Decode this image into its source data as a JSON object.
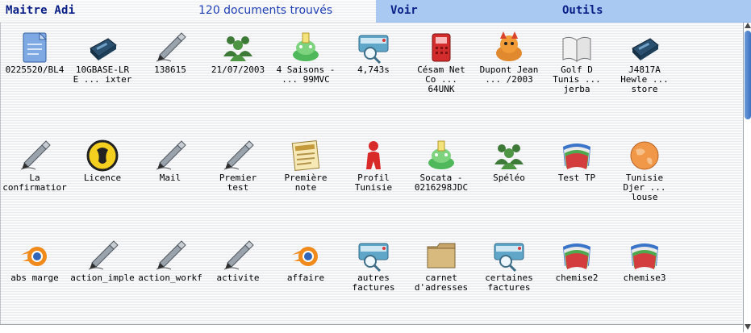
{
  "header": {
    "app_title": "Maitre Adi",
    "doc_count": "120 documents trouvés",
    "menu_voir": "Voir",
    "menu_outils": "Outils"
  },
  "colors": {
    "accent": "#a9c9f2",
    "title": "#0a1f86",
    "count": "#1f3fb3"
  },
  "items": [
    {
      "label": "0225520/BL4",
      "icon": "doc-icon"
    },
    {
      "label": "10GBASE-LR\nE ... ixter",
      "icon": "network-icon"
    },
    {
      "label": "138615",
      "icon": "pen-icon"
    },
    {
      "label": "21/07/2003",
      "icon": "people-icon"
    },
    {
      "label": "4 Saisons -\n... 99MVC",
      "icon": "frog-icon"
    },
    {
      "label": "4,743s",
      "icon": "search-doc-icon"
    },
    {
      "label": "Césam Net\nCo ...\n64UNK",
      "icon": "phone-icon"
    },
    {
      "label": "Dupont Jean\n... /2003",
      "icon": "fox-icon"
    },
    {
      "label": "Golf D\nTunis ...\njerba",
      "icon": "book-icon"
    },
    {
      "label": "J4817A\nHewle ...\nstore",
      "icon": "network-icon"
    },
    {
      "label": "La\nconfirmatior",
      "icon": "pen-icon"
    },
    {
      "label": "Licence",
      "icon": "gnu-icon"
    },
    {
      "label": "Mail",
      "icon": "pen-icon"
    },
    {
      "label": "Premier\ntest",
      "icon": "pen-icon"
    },
    {
      "label": "Première\nnote",
      "icon": "news-icon"
    },
    {
      "label": "Profil\nTunisie",
      "icon": "person-icon"
    },
    {
      "label": "Socata -\n0216298JDC",
      "icon": "frog-icon"
    },
    {
      "label": "Spéléo",
      "icon": "people-icon"
    },
    {
      "label": "Test TP",
      "icon": "folder-stack-icon"
    },
    {
      "label": "Tunisie\nDjer ...\nlouse",
      "icon": "globe-icon"
    },
    {
      "label": "abs marge",
      "icon": "blender-icon"
    },
    {
      "label": "action_imple",
      "icon": "pen-icon"
    },
    {
      "label": "action_workf",
      "icon": "pen-icon"
    },
    {
      "label": "activite",
      "icon": "pen-icon"
    },
    {
      "label": "affaire",
      "icon": "blender-icon"
    },
    {
      "label": "autres\nfactures",
      "icon": "search-doc-icon"
    },
    {
      "label": "carnet\nd'adresses",
      "icon": "folder-icon"
    },
    {
      "label": "certaines\nfactures",
      "icon": "search-doc-icon"
    },
    {
      "label": "chemise2",
      "icon": "folder-stack-icon"
    },
    {
      "label": "chemise3",
      "icon": "folder-stack-icon"
    }
  ]
}
